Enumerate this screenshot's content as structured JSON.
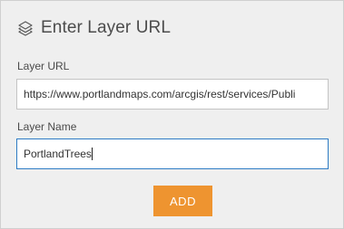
{
  "dialog": {
    "title": "Enter Layer URL",
    "icon": "layers-icon"
  },
  "form": {
    "url_label": "Layer URL",
    "url_value": "https://www.portlandmaps.com/arcgis/rest/services/Publi",
    "name_label": "Layer Name",
    "name_value": "PortlandTrees",
    "add_label": "ADD"
  },
  "colors": {
    "background": "#efefef",
    "accent": "#ee9430",
    "focus_border": "#2e7bc4"
  }
}
